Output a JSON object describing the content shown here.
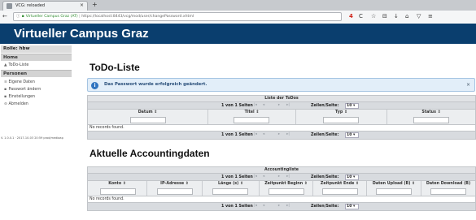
{
  "browser": {
    "tab_title": "VCG: reloaded",
    "tab_close": "×",
    "new_tab": "+",
    "url_site": "Virtueller Campus Graz (AT)",
    "url_path": "https://localhost:8443/vcg/mod/user/changePassword.xhtml",
    "badge": "4",
    "nav": {
      "back": "←",
      "lock": "ⓘ"
    },
    "toolbar_icons": [
      "C",
      "☆",
      "⊟",
      "↓",
      "⌂",
      "▽",
      "≡"
    ]
  },
  "app": {
    "title": "Virtueller Campus Graz"
  },
  "sidebar": {
    "rolle": "Rolle: hbw",
    "home_heading": "Home",
    "home_items": [
      {
        "icon": "▲",
        "label": "ToDo-Liste"
      }
    ],
    "personen_heading": "Personen",
    "personen_items": [
      {
        "icon": "≡",
        "label": "Eigene Daten"
      },
      {
        "icon": "▪",
        "label": "Passwort ändern"
      },
      {
        "icon": "▪",
        "label": "Einstellungen"
      },
      {
        "icon": "⊝",
        "label": "Abmelden"
      }
    ],
    "version": "V. 1.0.0.1 · 2017-10-03 20:59 prod/mediaap"
  },
  "main": {
    "todo_heading": "ToDo-Liste",
    "message": "Das Passwort wurde erfolgreich geändert.",
    "message_close": "×",
    "todo_table": {
      "caption": "Liste der ToDos",
      "pager_text": "1 von 1 Seiten",
      "rows_label": "Zeilen/Seite:",
      "rows_value": "10",
      "columns": [
        "Datum ⇕",
        "Titel ⇕",
        "Typ ⇕",
        "Status ⇕"
      ],
      "empty": "No records found."
    },
    "accounting_heading": "Aktuelle Accountingdaten",
    "accounting_table": {
      "caption": "Accountingliste",
      "pager_text": "1 von 1 Seiten",
      "rows_label": "Zeilen/Seite:",
      "rows_value": "10",
      "columns": [
        "Konto ⇕",
        "IP-Adresse ⇕",
        "Länge (s) ⇕",
        "Zeitpunkt Beginn ⇕",
        "Zeitpunkt Ende ⇕",
        "Daten Upload (B) ⇕",
        "Daten Download (B)"
      ],
      "empty": "No records found."
    },
    "pager_buttons": [
      "|◂",
      "◂",
      "▸",
      "▸|"
    ]
  },
  "colors": {
    "brand": "#0a3e6e",
    "info": "#2f74c0",
    "badge": "#d0241a"
  }
}
